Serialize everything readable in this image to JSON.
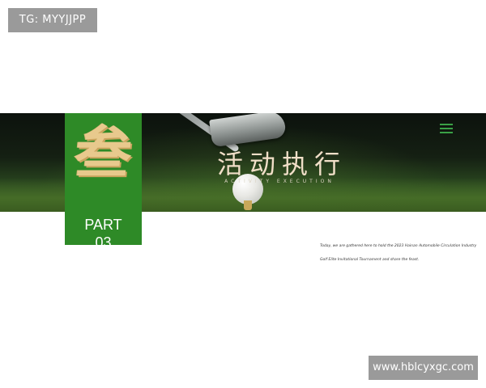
{
  "watermarks": {
    "top": "TG: MYYJJPP",
    "bottom": "www.hblcyxgc.com"
  },
  "banner": {
    "title": "活动执行",
    "subtitle": "ACTIVITY EXECUTION",
    "menu_icon": "hamburger-menu-icon"
  },
  "part": {
    "calligraphy": "叁",
    "label": "PART",
    "number": "03"
  },
  "description": "Today, we are gathered here to hold the 2023 Hainan Automobile Circulation Industry Golf Elite Invitational Tournament and share the feast.",
  "colors": {
    "part_green": "#2e8a27",
    "calligraphy_gold": "#e8c98d",
    "title_cream": "#f1dfc8",
    "menu_green": "#3aa046",
    "watermark_gray": "#9a9a9a"
  }
}
